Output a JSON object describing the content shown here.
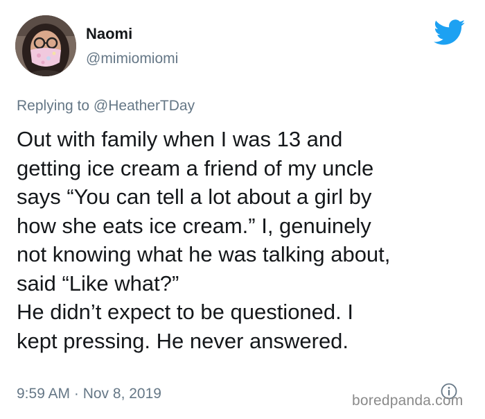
{
  "author": {
    "display_name": "Naomi",
    "handle": "@mimiomiomi"
  },
  "reply_context": {
    "prefix": "Replying to",
    "mention": "@HeatherTDay"
  },
  "tweet": {
    "lines": [
      "Out with family when I was 13 and",
      "getting ice cream a friend of my uncle",
      "says “You can tell a lot about a girl by",
      "how she eats ice cream.” I, genuinely",
      "not knowing what he was talking about,",
      "said “Like what?”",
      "He didn’t expect to be questioned. I",
      "kept pressing. He never answered."
    ],
    "timestamp": "9:59 AM · Nov 8, 2019"
  },
  "icons": {
    "brand": "twitter-bird-icon",
    "info": "info-icon"
  },
  "watermark": "boredpanda.com",
  "colors": {
    "twitter_blue": "#1da1f2",
    "text_primary": "#14171a",
    "text_secondary": "#657786"
  }
}
